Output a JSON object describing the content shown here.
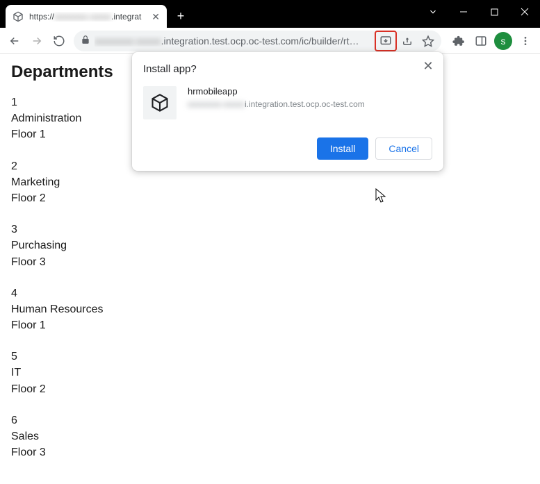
{
  "browser": {
    "tab_title_prefix": "https://",
    "tab_title_suffix": ".integrat",
    "url_suffix": ".integration.test.ocp.oc-test.com/ic/builder/rt…",
    "avatar_letter": "s"
  },
  "popup": {
    "title": "Install app?",
    "app_name": "hrmobileapp",
    "origin_suffix": "i.integration.test.ocp.oc-test.com",
    "install_label": "Install",
    "cancel_label": "Cancel"
  },
  "page": {
    "heading": "Departments",
    "departments": [
      {
        "id": "1",
        "name": "Administration",
        "floor": "Floor 1"
      },
      {
        "id": "2",
        "name": "Marketing",
        "floor": "Floor 2"
      },
      {
        "id": "3",
        "name": "Purchasing",
        "floor": "Floor 3"
      },
      {
        "id": "4",
        "name": "Human Resources",
        "floor": "Floor 1"
      },
      {
        "id": "5",
        "name": "IT",
        "floor": "Floor 2"
      },
      {
        "id": "6",
        "name": "Sales",
        "floor": "Floor 3"
      }
    ]
  }
}
